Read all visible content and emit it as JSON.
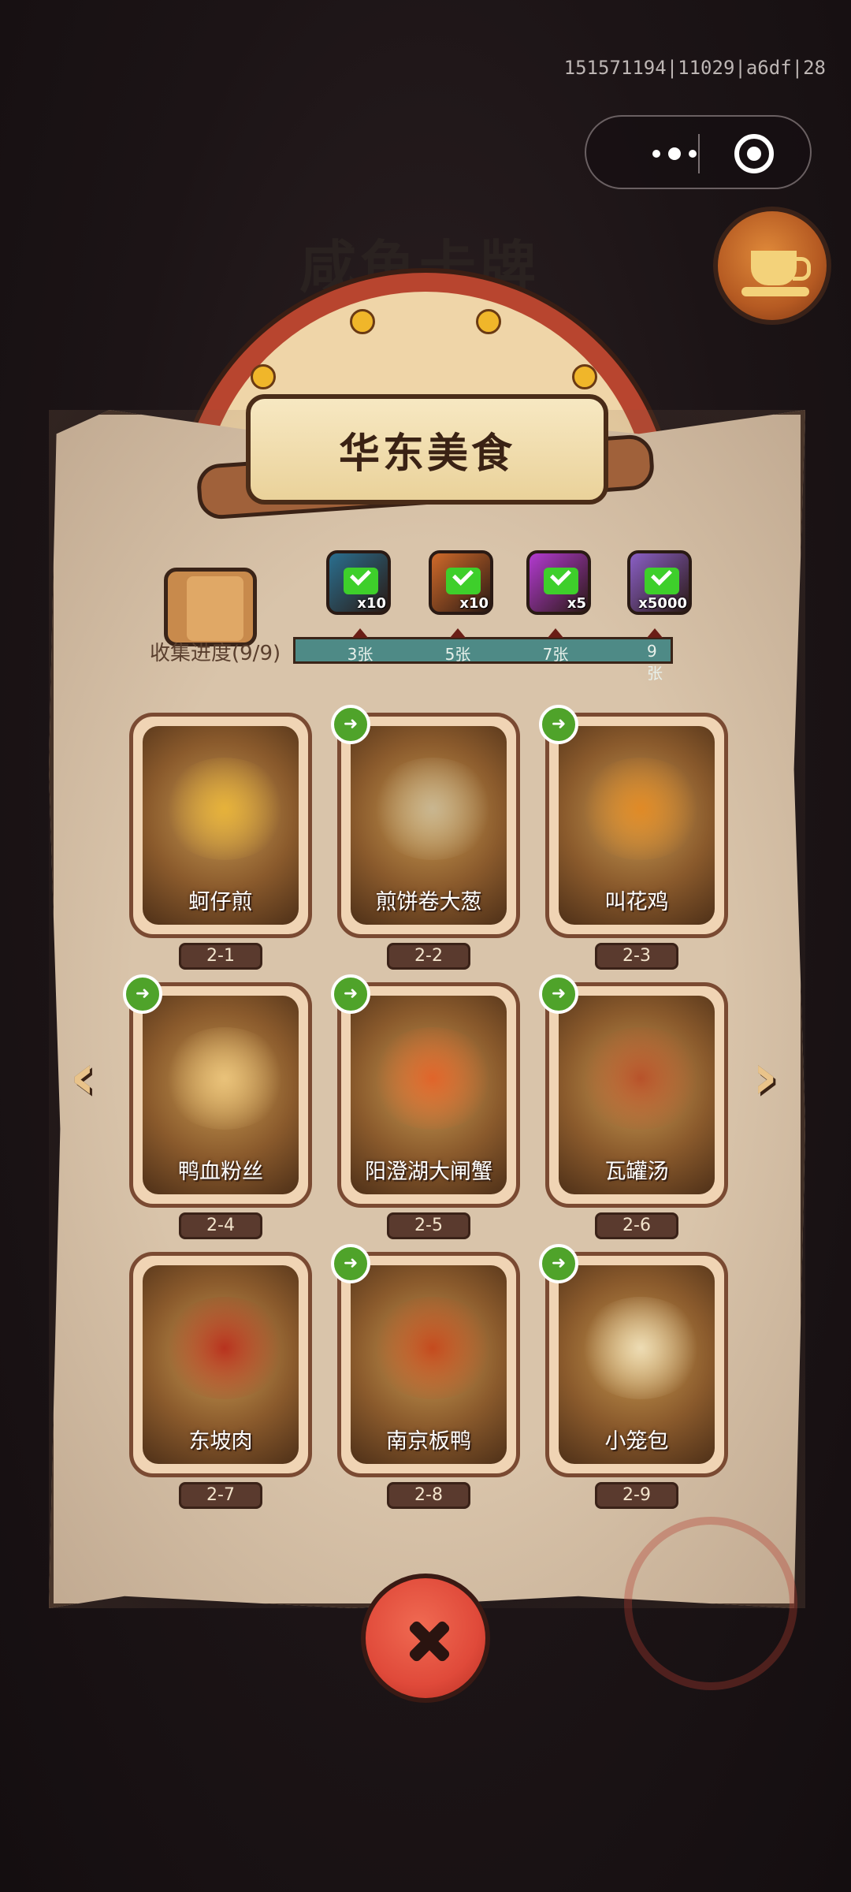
{
  "debug_id": "151571194|11029|a6df|28",
  "background": {
    "ghost_title": "咸鱼卡牌"
  },
  "panel": {
    "title": "华东美食"
  },
  "progress": {
    "label": "收集进度(9/9)",
    "milestones": [
      {
        "label": "3张",
        "reward_qty": "x10",
        "color": "#2a6f8f",
        "claimed": true
      },
      {
        "label": "5张",
        "reward_qty": "x10",
        "color": "#d06a2a",
        "claimed": true
      },
      {
        "label": "7张",
        "reward_qty": "x5",
        "color": "#b23ad0",
        "claimed": true
      },
      {
        "label": "9张",
        "reward_qty": "x5000",
        "color": "#8a5fc6",
        "claimed": true
      }
    ]
  },
  "cards": [
    {
      "name": "蚵仔煎",
      "tag": "2-1",
      "shareable": false,
      "art_color": "#e6b23a"
    },
    {
      "name": "煎饼卷大葱",
      "tag": "2-2",
      "shareable": true,
      "art_color": "#c9b690"
    },
    {
      "name": "叫花鸡",
      "tag": "2-3",
      "shareable": true,
      "art_color": "#e08a26"
    },
    {
      "name": "鸭血粉丝",
      "tag": "2-4",
      "shareable": true,
      "art_color": "#e9c27a"
    },
    {
      "name": "阳澄湖大闸蟹",
      "tag": "2-5",
      "shareable": true,
      "art_color": "#e0642a"
    },
    {
      "name": "瓦罐汤",
      "tag": "2-6",
      "shareable": true,
      "art_color": "#b8522a"
    },
    {
      "name": "东坡肉",
      "tag": "2-7",
      "shareable": false,
      "art_color": "#b8321e"
    },
    {
      "name": "南京板鸭",
      "tag": "2-8",
      "shareable": true,
      "art_color": "#c44a1e"
    },
    {
      "name": "小笼包",
      "tag": "2-9",
      "shareable": true,
      "art_color": "#eddcb4"
    }
  ],
  "icons": {
    "prev": "chevron-left-icon",
    "next": "chevron-right-icon",
    "close": "close-icon",
    "share": "share-icon"
  }
}
